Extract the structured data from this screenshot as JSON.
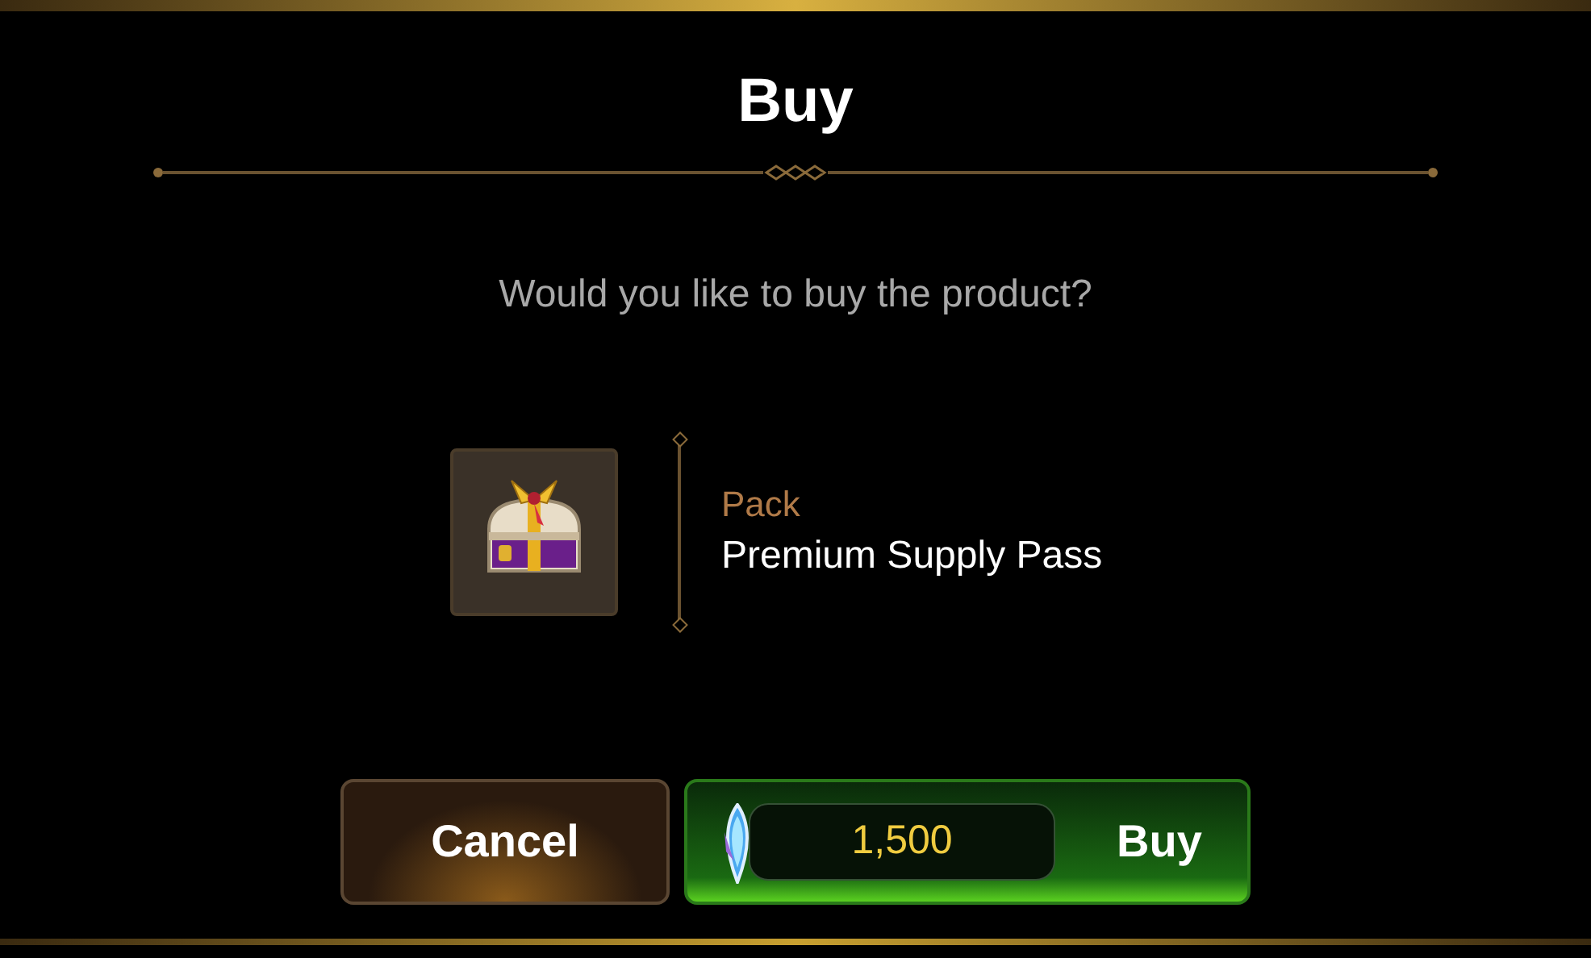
{
  "dialog": {
    "title": "Buy",
    "message": "Would you like to buy the product?"
  },
  "product": {
    "category": "Pack",
    "name": "Premium Supply Pass"
  },
  "buttons": {
    "cancel": "Cancel",
    "price": "1,500",
    "buy": "Buy"
  }
}
